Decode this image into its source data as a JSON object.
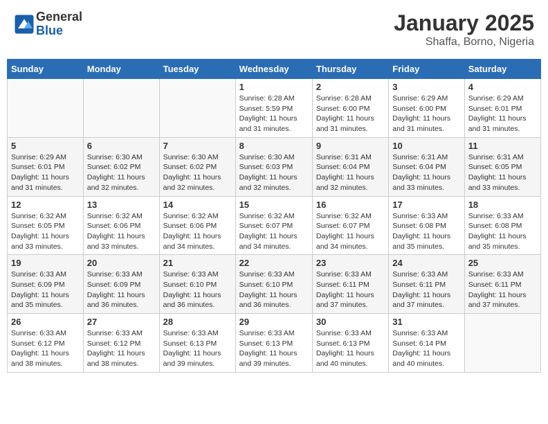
{
  "header": {
    "logo_general": "General",
    "logo_blue": "Blue",
    "title": "January 2025",
    "location": "Shaffa, Borno, Nigeria"
  },
  "days_of_week": [
    "Sunday",
    "Monday",
    "Tuesday",
    "Wednesday",
    "Thursday",
    "Friday",
    "Saturday"
  ],
  "weeks": [
    [
      {
        "day": "",
        "info": ""
      },
      {
        "day": "",
        "info": ""
      },
      {
        "day": "",
        "info": ""
      },
      {
        "day": "1",
        "info": "Sunrise: 6:28 AM\nSunset: 5:59 PM\nDaylight: 11 hours and 31 minutes."
      },
      {
        "day": "2",
        "info": "Sunrise: 6:28 AM\nSunset: 6:00 PM\nDaylight: 11 hours and 31 minutes."
      },
      {
        "day": "3",
        "info": "Sunrise: 6:29 AM\nSunset: 6:00 PM\nDaylight: 11 hours and 31 minutes."
      },
      {
        "day": "4",
        "info": "Sunrise: 6:29 AM\nSunset: 6:01 PM\nDaylight: 11 hours and 31 minutes."
      }
    ],
    [
      {
        "day": "5",
        "info": "Sunrise: 6:29 AM\nSunset: 6:01 PM\nDaylight: 11 hours and 31 minutes."
      },
      {
        "day": "6",
        "info": "Sunrise: 6:30 AM\nSunset: 6:02 PM\nDaylight: 11 hours and 32 minutes."
      },
      {
        "day": "7",
        "info": "Sunrise: 6:30 AM\nSunset: 6:02 PM\nDaylight: 11 hours and 32 minutes."
      },
      {
        "day": "8",
        "info": "Sunrise: 6:30 AM\nSunset: 6:03 PM\nDaylight: 11 hours and 32 minutes."
      },
      {
        "day": "9",
        "info": "Sunrise: 6:31 AM\nSunset: 6:04 PM\nDaylight: 11 hours and 32 minutes."
      },
      {
        "day": "10",
        "info": "Sunrise: 6:31 AM\nSunset: 6:04 PM\nDaylight: 11 hours and 33 minutes."
      },
      {
        "day": "11",
        "info": "Sunrise: 6:31 AM\nSunset: 6:05 PM\nDaylight: 11 hours and 33 minutes."
      }
    ],
    [
      {
        "day": "12",
        "info": "Sunrise: 6:32 AM\nSunset: 6:05 PM\nDaylight: 11 hours and 33 minutes."
      },
      {
        "day": "13",
        "info": "Sunrise: 6:32 AM\nSunset: 6:06 PM\nDaylight: 11 hours and 33 minutes."
      },
      {
        "day": "14",
        "info": "Sunrise: 6:32 AM\nSunset: 6:06 PM\nDaylight: 11 hours and 34 minutes."
      },
      {
        "day": "15",
        "info": "Sunrise: 6:32 AM\nSunset: 6:07 PM\nDaylight: 11 hours and 34 minutes."
      },
      {
        "day": "16",
        "info": "Sunrise: 6:32 AM\nSunset: 6:07 PM\nDaylight: 11 hours and 34 minutes."
      },
      {
        "day": "17",
        "info": "Sunrise: 6:33 AM\nSunset: 6:08 PM\nDaylight: 11 hours and 35 minutes."
      },
      {
        "day": "18",
        "info": "Sunrise: 6:33 AM\nSunset: 6:08 PM\nDaylight: 11 hours and 35 minutes."
      }
    ],
    [
      {
        "day": "19",
        "info": "Sunrise: 6:33 AM\nSunset: 6:09 PM\nDaylight: 11 hours and 35 minutes."
      },
      {
        "day": "20",
        "info": "Sunrise: 6:33 AM\nSunset: 6:09 PM\nDaylight: 11 hours and 36 minutes."
      },
      {
        "day": "21",
        "info": "Sunrise: 6:33 AM\nSunset: 6:10 PM\nDaylight: 11 hours and 36 minutes."
      },
      {
        "day": "22",
        "info": "Sunrise: 6:33 AM\nSunset: 6:10 PM\nDaylight: 11 hours and 36 minutes."
      },
      {
        "day": "23",
        "info": "Sunrise: 6:33 AM\nSunset: 6:11 PM\nDaylight: 11 hours and 37 minutes."
      },
      {
        "day": "24",
        "info": "Sunrise: 6:33 AM\nSunset: 6:11 PM\nDaylight: 11 hours and 37 minutes."
      },
      {
        "day": "25",
        "info": "Sunrise: 6:33 AM\nSunset: 6:11 PM\nDaylight: 11 hours and 37 minutes."
      }
    ],
    [
      {
        "day": "26",
        "info": "Sunrise: 6:33 AM\nSunset: 6:12 PM\nDaylight: 11 hours and 38 minutes."
      },
      {
        "day": "27",
        "info": "Sunrise: 6:33 AM\nSunset: 6:12 PM\nDaylight: 11 hours and 38 minutes."
      },
      {
        "day": "28",
        "info": "Sunrise: 6:33 AM\nSunset: 6:13 PM\nDaylight: 11 hours and 39 minutes."
      },
      {
        "day": "29",
        "info": "Sunrise: 6:33 AM\nSunset: 6:13 PM\nDaylight: 11 hours and 39 minutes."
      },
      {
        "day": "30",
        "info": "Sunrise: 6:33 AM\nSunset: 6:13 PM\nDaylight: 11 hours and 40 minutes."
      },
      {
        "day": "31",
        "info": "Sunrise: 6:33 AM\nSunset: 6:14 PM\nDaylight: 11 hours and 40 minutes."
      },
      {
        "day": "",
        "info": ""
      }
    ]
  ]
}
